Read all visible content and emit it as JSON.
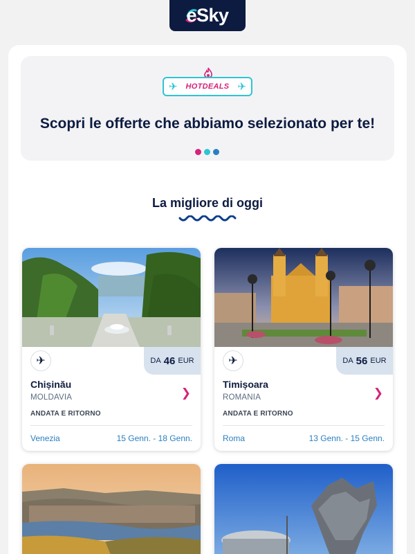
{
  "header": {
    "logo_text": "eSky"
  },
  "banner": {
    "badge_label": "HOTDEALS",
    "title": "Scopri le offerte che abbiamo selezionato per te!",
    "dots_colors": [
      "#d4237a",
      "#2ec5d3",
      "#2a7fbf"
    ]
  },
  "section": {
    "title": "La migliore di oggi"
  },
  "offers": [
    {
      "city": "Chișinău",
      "country": "MOLDAVIA",
      "price_prefix": "DA",
      "price": "46",
      "currency": "EUR",
      "trip_type": "ANDATA E RITORNO",
      "from": "Venezia",
      "dates": "15 Genn. - 18 Genn.",
      "icon": "plane-icon"
    },
    {
      "city": "Timișoara",
      "country": "ROMANIA",
      "price_prefix": "DA",
      "price": "56",
      "currency": "EUR",
      "trip_type": "ANDATA E RITORNO",
      "from": "Roma",
      "dates": "13 Genn. - 15 Genn.",
      "icon": "plane-icon"
    }
  ],
  "colors": {
    "brand_navy": "#0d1b40",
    "accent_pink": "#d4237a",
    "accent_cyan": "#2ec5d3",
    "link_blue": "#2a7fbf"
  }
}
